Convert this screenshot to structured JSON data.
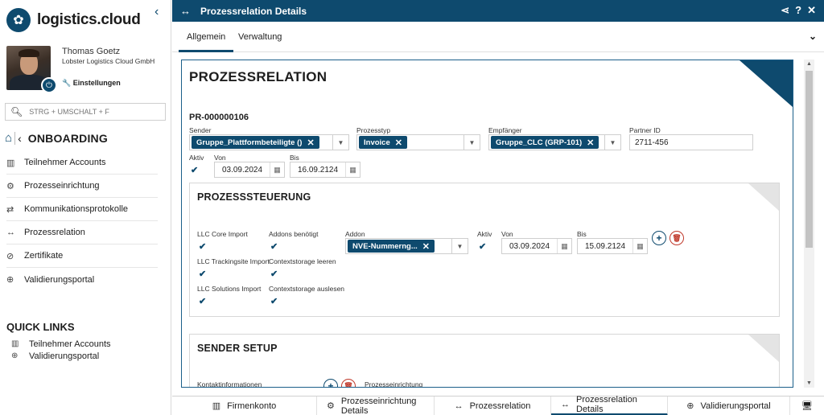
{
  "app": {
    "brand": "logistics.cloud",
    "accent": "#0e4a6e"
  },
  "user": {
    "name": "Thomas Goetz",
    "company": "Lobster Logistics Cloud GmbH",
    "settings_label": "Einstellungen"
  },
  "search": {
    "placeholder": "STRG + UMSCHALT + F"
  },
  "sidebar": {
    "section_title": "ONBOARDING",
    "items": [
      {
        "label": "Teilnehmer Accounts",
        "icon": "building-icon"
      },
      {
        "label": "Prozesseinrichtung",
        "icon": "gears-icon"
      },
      {
        "label": "Kommunikationsprotokolle",
        "icon": "exchange-icon"
      },
      {
        "label": "Prozessrelation",
        "icon": "arrows-horizontal-icon"
      },
      {
        "label": "Zertifikate",
        "icon": "certificate-icon"
      },
      {
        "label": "Validierungsportal",
        "icon": "magnify-check-icon"
      }
    ],
    "quick_links_title": "QUICK LINKS",
    "quick_links": [
      {
        "label": "Teilnehmer Accounts",
        "icon": "building-icon"
      },
      {
        "label": "Validierungsportal",
        "icon": "magnify-check-icon"
      }
    ]
  },
  "header": {
    "title": "Prozessrelation Details"
  },
  "tabs": [
    {
      "label": "Allgemein",
      "active": true
    },
    {
      "label": "Verwaltung",
      "active": false
    }
  ],
  "form": {
    "heading": "PROZESSRELATION",
    "id": "PR-000000106",
    "sender_label": "Sender",
    "sender_value": "Gruppe_Plattformbeteiligte ()",
    "prozesstyp_label": "Prozesstyp",
    "prozesstyp_value": "Invoice",
    "empfaenger_label": "Empfänger",
    "empfaenger_value": "Gruppe_CLC (GRP-101)",
    "partner_label": "Partner ID",
    "partner_value": "2711-456",
    "aktiv_label": "Aktiv",
    "aktiv_checked": true,
    "von_label": "Von",
    "von_value": "03.09.2024",
    "bis_label": "Bis",
    "bis_value": "16.09.2124"
  },
  "steuerung": {
    "title": "PROZESSSTEUERUNG",
    "llc_core_import": "LLC Core Import",
    "llc_trackingsite_import": "LLC Trackingsite Import",
    "llc_solutions_import": "LLC Solutions Import",
    "addons_benoetigt": "Addons benötigt",
    "contextstorage_leeren": "Contextstorage leeren",
    "contextstorage_auslesen": "Contextstorage auslesen",
    "addon_label": "Addon",
    "addon_value": "NVE-Nummerng...",
    "aktiv_label": "Aktiv",
    "von_label": "Von",
    "von_value": "03.09.2024",
    "bis_label": "Bis",
    "bis_value": "15.09.2124"
  },
  "sender_setup": {
    "title": "SENDER SETUP",
    "kontakt_label": "Kontaktinformationen",
    "prozess_label": "Prozesseinrichtung"
  },
  "bottom_tabs": [
    {
      "label": "Firmenkonto",
      "icon": "building-icon",
      "active": false
    },
    {
      "label": "Prozesseinrichtung Details",
      "icon": "gears-icon",
      "active": false
    },
    {
      "label": "Prozessrelation",
      "icon": "arrows-horizontal-icon",
      "active": false
    },
    {
      "label": "Prozessrelation Details",
      "icon": "arrows-horizontal-icon",
      "active": true
    },
    {
      "label": "Validierungsportal",
      "icon": "magnify-check-icon",
      "active": false
    }
  ]
}
